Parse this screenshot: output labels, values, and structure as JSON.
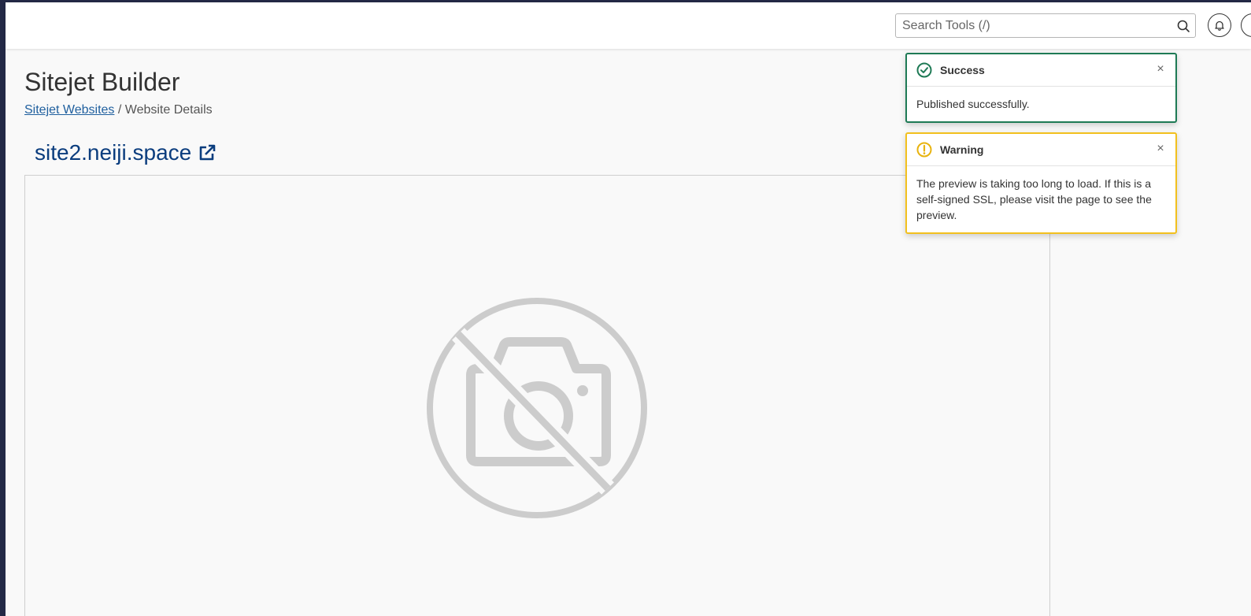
{
  "header": {
    "search_placeholder": "Search Tools (/)"
  },
  "page": {
    "title": "Sitejet Builder",
    "breadcrumb": {
      "parent_label": "Sitejet Websites",
      "separator": " / ",
      "current_label": "Website Details"
    },
    "site_link_label": "site2.neiji.space"
  },
  "toasts": {
    "success": {
      "title": "Success",
      "message": "Published successfully.",
      "close_glyph": "×",
      "color": "#1e7a55"
    },
    "warning": {
      "title": "Warning",
      "message": "The preview is taking too long to load. If this is a self-signed SSL, please visit the page to see the preview.",
      "close_glyph": "×",
      "color": "#f2c01e"
    }
  },
  "colors": {
    "sidebar_dark": "#232946",
    "link_blue": "#0b3d7e",
    "breadcrumb_link": "#1f5f9e",
    "placeholder_icon": "#cccccc"
  },
  "icons": {
    "search": "search-icon",
    "bell": "bell-icon",
    "user": "user-icon",
    "external_link": "external-link-icon",
    "no_image": "no-image-icon",
    "success": "check-circle-icon",
    "warning": "exclamation-circle-icon",
    "close": "close-icon"
  }
}
